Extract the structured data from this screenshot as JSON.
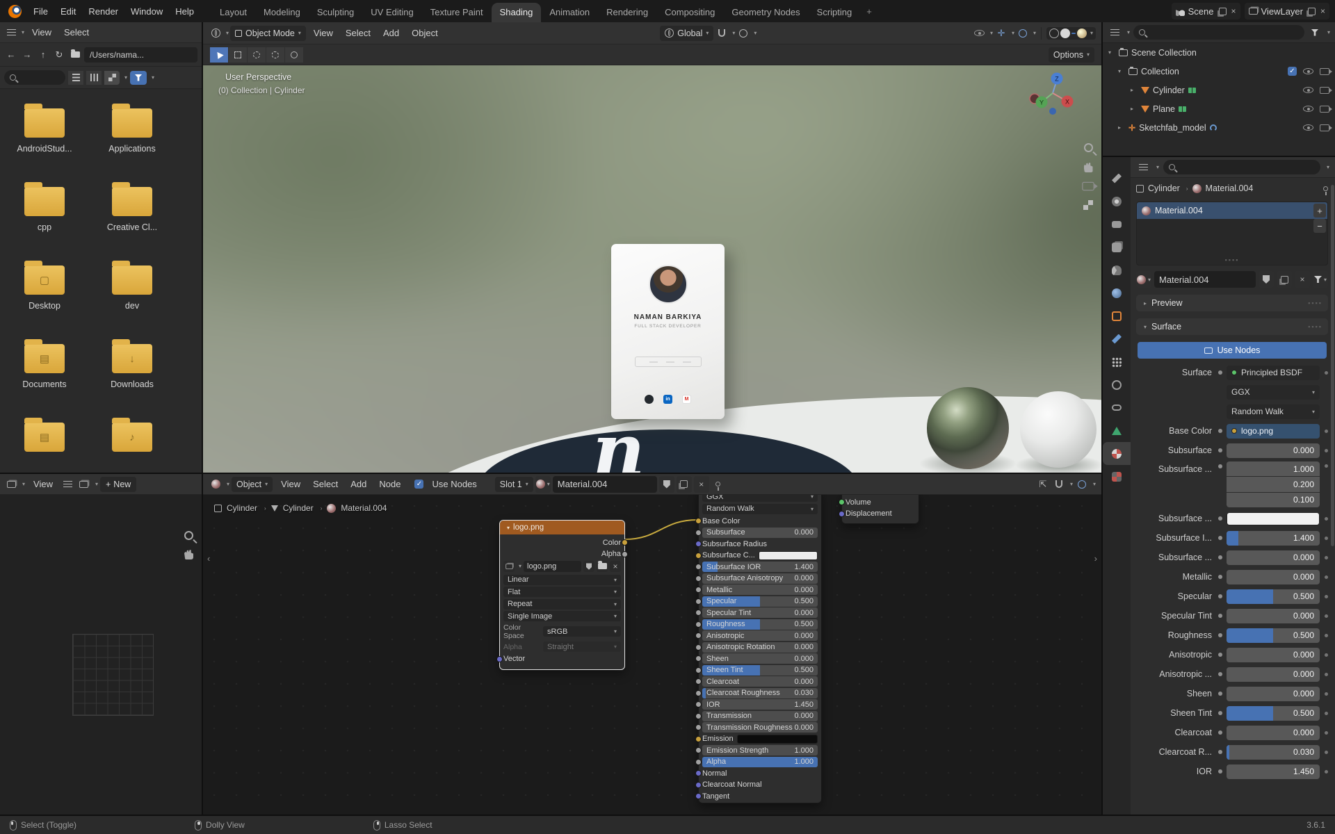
{
  "topbar": {
    "menus": [
      {
        "label": "File"
      },
      {
        "label": "Edit"
      },
      {
        "label": "Render"
      },
      {
        "label": "Window"
      },
      {
        "label": "Help"
      }
    ],
    "tabs": [
      {
        "label": "Layout",
        "state": "normal"
      },
      {
        "label": "Modeling",
        "state": "normal"
      },
      {
        "label": "Sculpting",
        "state": "normal"
      },
      {
        "label": "UV Editing",
        "state": "normal"
      },
      {
        "label": "Texture Paint",
        "state": "normal"
      },
      {
        "label": "Shading",
        "state": "active"
      },
      {
        "label": "Animation",
        "state": "normal"
      },
      {
        "label": "Rendering",
        "state": "normal"
      },
      {
        "label": "Compositing",
        "state": "normal"
      },
      {
        "label": "Geometry Nodes",
        "state": "normal"
      },
      {
        "label": "Scripting",
        "state": "normal"
      }
    ],
    "add_tab": "+",
    "scene": "Scene",
    "viewlayer": "ViewLayer"
  },
  "file_browser": {
    "menus": [
      {
        "label": "View"
      },
      {
        "label": "Select"
      }
    ],
    "path": "/Users/nama...",
    "folders": [
      {
        "name": "AndroidStud...",
        "badge": ""
      },
      {
        "name": "Applications",
        "badge": ""
      },
      {
        "name": "cpp",
        "badge": ""
      },
      {
        "name": "Creative Cl...",
        "badge": ""
      },
      {
        "name": "Desktop",
        "badge": "▢"
      },
      {
        "name": "dev",
        "badge": ""
      },
      {
        "name": "Documents",
        "badge": "▤"
      },
      {
        "name": "Downloads",
        "badge": "↓"
      },
      {
        "name": "",
        "badge": "▤"
      },
      {
        "name": "",
        "badge": "♪"
      }
    ]
  },
  "viewport": {
    "mode": "Object Mode",
    "menus": [
      {
        "label": "View"
      },
      {
        "label": "Select"
      },
      {
        "label": "Add"
      },
      {
        "label": "Object"
      }
    ],
    "orientation": "Global",
    "options_label": "Options",
    "overlay_perspective": "User Perspective",
    "overlay_collection": "(0) Collection | Cylinder",
    "axis_x": "X",
    "axis_y": "Y",
    "axis_z": "Z",
    "card": {
      "name": "NAMAN BARKIYA",
      "title": "FULL STACK DEVELOPER",
      "linkedin": "in",
      "gmail": "M"
    },
    "logo_letter": "n"
  },
  "outliner": {
    "root_label": "Scene Collection",
    "collection_label": "Collection",
    "check": "✓",
    "items": [
      {
        "label": "Cylinder"
      },
      {
        "label": "Plane"
      },
      {
        "label": "Sketchfab_model"
      }
    ]
  },
  "properties": {
    "ptabs": [
      {
        "icon": "tool"
      },
      {
        "icon": "render"
      },
      {
        "icon": "output"
      },
      {
        "icon": "viewlayer"
      },
      {
        "icon": "scene"
      },
      {
        "icon": "world"
      },
      {
        "icon": "object"
      },
      {
        "icon": "modifiers"
      },
      {
        "icon": "particles"
      },
      {
        "icon": "physics"
      },
      {
        "icon": "constraints"
      },
      {
        "icon": "data"
      },
      {
        "icon": "material"
      },
      {
        "icon": "texture"
      }
    ],
    "breadcrumb_object": "Cylinder",
    "breadcrumb_material": "Material.004",
    "slot_item": "Material.004",
    "name_value": "Material.004",
    "minus": "−",
    "plus": "+",
    "preview_label": "Preview",
    "surface_label": "Surface",
    "use_nodes_label": "Use Nodes",
    "surface_row_label": "Surface",
    "surface_row_value": "Principled BSDF",
    "distribution": "GGX",
    "subsurface_method": "Random Walk",
    "rows": [
      {
        "type": "image",
        "label": "Base Color",
        "value": "logo.png"
      },
      {
        "type": "slider",
        "label": "Subsurface",
        "value": "0.000",
        "fill": "0%"
      },
      {
        "type": "vector",
        "label": "Subsurface ...",
        "values": [
          "1.000",
          "0.200",
          "0.100"
        ]
      },
      {
        "type": "color",
        "label": "Subsurface ...",
        "swatch": "#f2f2f2"
      },
      {
        "type": "slider",
        "label": "Subsurface I...",
        "value": "1.400",
        "fill": "13%"
      },
      {
        "type": "slider",
        "label": "Subsurface ...",
        "value": "0.000",
        "fill": "0%"
      },
      {
        "type": "slider",
        "label": "Metallic",
        "value": "0.000",
        "fill": "0%"
      },
      {
        "type": "slider",
        "label": "Specular",
        "value": "0.500",
        "fill": "50%"
      },
      {
        "type": "slider",
        "label": "Specular Tint",
        "value": "0.000",
        "fill": "0%"
      },
      {
        "type": "slider",
        "label": "Roughness",
        "value": "0.500",
        "fill": "50%"
      },
      {
        "type": "slider",
        "label": "Anisotropic",
        "value": "0.000",
        "fill": "0%"
      },
      {
        "type": "slider",
        "label": "Anisotropic ...",
        "value": "0.000",
        "fill": "0%"
      },
      {
        "type": "slider",
        "label": "Sheen",
        "value": "0.000",
        "fill": "0%"
      },
      {
        "type": "slider",
        "label": "Sheen Tint",
        "value": "0.500",
        "fill": "50%"
      },
      {
        "type": "slider",
        "label": "Clearcoat",
        "value": "0.000",
        "fill": "0%"
      },
      {
        "type": "slider",
        "label": "Clearcoat R...",
        "value": "0.030",
        "fill": "3%"
      },
      {
        "type": "slider",
        "label": "IOR",
        "value": "1.450",
        "fill": "0%"
      }
    ]
  },
  "image_editor": {
    "menu_view": "View",
    "new_label": "New"
  },
  "shader_editor": {
    "object_selector": "Object",
    "menus": [
      {
        "label": "View"
      },
      {
        "label": "Select"
      },
      {
        "label": "Add"
      },
      {
        "label": "Node"
      }
    ],
    "use_nodes_label": "Use Nodes",
    "slot_label": "Slot 1",
    "material_name": "Material.004",
    "breadcrumb_object": "Cylinder",
    "breadcrumb_data": "Cylinder",
    "breadcrumb_material": "Material.004",
    "image_node": {
      "title": "logo.png",
      "out_color": "Color",
      "out_alpha": "Alpha",
      "image_name": "logo.png",
      "interpolation": "Linear",
      "projection": "Flat",
      "extension": "Repeat",
      "source": "Single Image",
      "color_space_label": "Color Space",
      "color_space_value": "sRGB",
      "alpha_label": "Alpha",
      "alpha_value": "Straight",
      "vector_label": "Vector"
    },
    "bsdf_node": {
      "distribution": "GGX",
      "method": "Random Walk",
      "rows": [
        {
          "type": "plain",
          "label": "Base Color",
          "socket": "yellow"
        },
        {
          "type": "slider",
          "label": "Subsurface",
          "value": "0.000",
          "fill": "0%",
          "socket": "grey"
        },
        {
          "type": "plain",
          "label": "Subsurface Radius",
          "socket": "purple"
        },
        {
          "type": "color",
          "label": "Subsurface C...",
          "swatch": "#ececec",
          "socket": "yellow"
        },
        {
          "type": "slider",
          "label": "Subsurface IOR",
          "value": "1.400",
          "fill": "13%",
          "socket": "grey"
        },
        {
          "type": "slider",
          "label": "Subsurface Anisotropy",
          "value": "0.000",
          "fill": "0%",
          "socket": "grey"
        },
        {
          "type": "slider",
          "label": "Metallic",
          "value": "0.000",
          "fill": "0%",
          "socket": "grey"
        },
        {
          "type": "slider",
          "label": "Specular",
          "value": "0.500",
          "fill": "50%",
          "socket": "grey"
        },
        {
          "type": "slider",
          "label": "Specular Tint",
          "value": "0.000",
          "fill": "0%",
          "socket": "grey"
        },
        {
          "type": "slider",
          "label": "Roughness",
          "value": "0.500",
          "fill": "50%",
          "socket": "grey"
        },
        {
          "type": "slider",
          "label": "Anisotropic",
          "value": "0.000",
          "fill": "0%",
          "socket": "grey"
        },
        {
          "type": "slider",
          "label": "Anisotropic Rotation",
          "value": "0.000",
          "fill": "0%",
          "socket": "grey"
        },
        {
          "type": "slider",
          "label": "Sheen",
          "value": "0.000",
          "fill": "0%",
          "socket": "grey"
        },
        {
          "type": "slider",
          "label": "Sheen Tint",
          "value": "0.500",
          "fill": "50%",
          "socket": "grey"
        },
        {
          "type": "slider",
          "label": "Clearcoat",
          "value": "0.000",
          "fill": "0%",
          "socket": "grey"
        },
        {
          "type": "slider",
          "label": "Clearcoat Roughness",
          "value": "0.030",
          "fill": "3%",
          "socket": "grey"
        },
        {
          "type": "slider",
          "label": "IOR",
          "value": "1.450",
          "fill": "0%",
          "socket": "grey"
        },
        {
          "type": "slider",
          "label": "Transmission",
          "value": "0.000",
          "fill": "0%",
          "socket": "grey"
        },
        {
          "type": "slider",
          "label": "Transmission Roughness",
          "value": "0.000",
          "fill": "0%",
          "socket": "grey"
        },
        {
          "type": "color",
          "label": "Emission",
          "swatch": "#0c0c0c",
          "socket": "yellow"
        },
        {
          "type": "slider",
          "label": "Emission Strength",
          "value": "1.000",
          "fill": "0%",
          "socket": "grey"
        },
        {
          "type": "slider",
          "label": "Alpha",
          "value": "1.000",
          "fill": "100%",
          "socket": "grey"
        },
        {
          "type": "plain",
          "label": "Normal",
          "socket": "blue"
        },
        {
          "type": "plain",
          "label": "Clearcoat Normal",
          "socket": "blue"
        },
        {
          "type": "plain",
          "label": "Tangent",
          "socket": "blue"
        }
      ]
    },
    "output_node": {
      "volume_label": "Volume",
      "displacement_label": "Displacement"
    }
  },
  "statusbar": {
    "select_hint": "Select (Toggle)",
    "dolly_hint": "Dolly View",
    "lasso_hint": "Lasso Select",
    "version": "3.6.1"
  }
}
